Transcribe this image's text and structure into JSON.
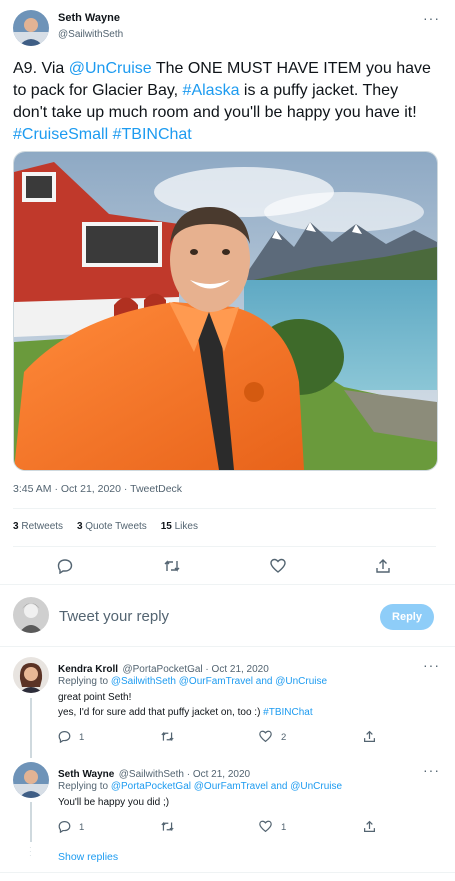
{
  "tweet": {
    "author_name": "Seth Wayne",
    "author_handle": "@SailwithSeth",
    "text_parts": [
      {
        "t": "A9. Via ",
        "link": false
      },
      {
        "t": "@UnCruise",
        "link": true
      },
      {
        "t": " The ONE MUST HAVE ITEM you have to pack for Glacier Bay, ",
        "link": false
      },
      {
        "t": "#Alaska",
        "link": true
      },
      {
        "t": " is a puffy jacket. They don't take up much room and you'll be happy you have it! ",
        "link": false
      },
      {
        "t": "#CruiseSmall",
        "link": true
      },
      {
        "t": " ",
        "link": false
      },
      {
        "t": "#TBINChat",
        "link": true
      }
    ],
    "timestamp": "3:45 AM · Oct 21, 2020 · TweetDeck",
    "retweets_count": "3",
    "retweets_label": "Retweets",
    "quotes_count": "3",
    "quotes_label": "Quote Tweets",
    "likes_count": "15",
    "likes_label": "Likes"
  },
  "compose": {
    "placeholder": "Tweet your reply",
    "reply_button": "Reply"
  },
  "replies": [
    {
      "name": "Kendra Kroll",
      "meta": "@PortaPocketGal · Oct 21, 2020",
      "replying_prefix": "Replying to ",
      "replying_to": "@SailwithSeth @OurFamTravel and @UnCruise",
      "line1": "great point Seth!",
      "line2_text": "yes, I'd for sure add that puffy jacket on, too :) ",
      "line2_tag": "#TBINChat",
      "reply_count": "1",
      "like_count": "2"
    },
    {
      "name": "Seth Wayne",
      "meta": "@SailwithSeth · Oct 21, 2020",
      "replying_prefix": "Replying to ",
      "replying_to": "@PortaPocketGal @OurFamTravel and @UnCruise",
      "line1": "You'll be happy you did ;)",
      "reply_count": "1",
      "like_count": "1"
    }
  ],
  "show_replies": "Show replies",
  "colors": {
    "accent": "#1d9bf0",
    "reply_button_disabled": "#8ecdf8",
    "secondary_text": "#536471"
  }
}
